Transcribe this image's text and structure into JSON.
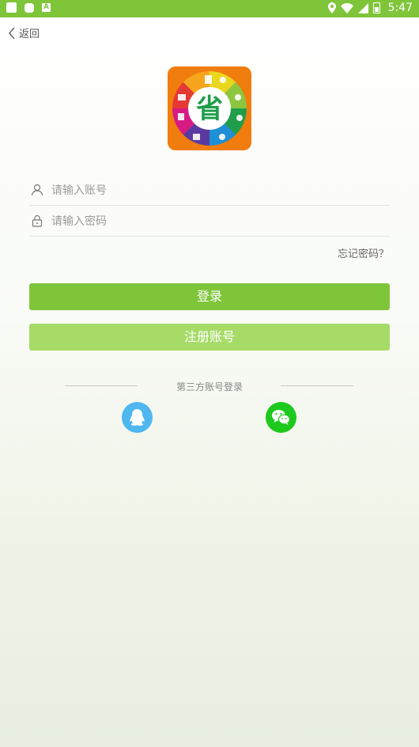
{
  "status_bar": {
    "time": "5:47",
    "battery_level": 0.5,
    "bar_color": "#7fc53a"
  },
  "nav": {
    "back_label": "返回"
  },
  "logo": {
    "center_char": "省",
    "ring_colors": [
      "#e53935",
      "#f7a51c",
      "#e9d71f",
      "#8cc63f",
      "#1e9e4a",
      "#1f8fd6",
      "#5a3aa0",
      "#d81b83"
    ],
    "background": "#f07d0e"
  },
  "form": {
    "account_placeholder": "请输入账号",
    "password_placeholder": "请输入密码",
    "forgot_label": "忘记密码？"
  },
  "buttons": {
    "login_label": "登录",
    "register_label": "注册账号",
    "login_color": "#7fc53a",
    "register_color": "#a6db67"
  },
  "third_party": {
    "label": "第三方账号登录",
    "providers": [
      {
        "name": "qq-icon",
        "color": "#4fb7f0"
      },
      {
        "name": "wechat-icon",
        "color": "#1dc91d"
      }
    ]
  }
}
